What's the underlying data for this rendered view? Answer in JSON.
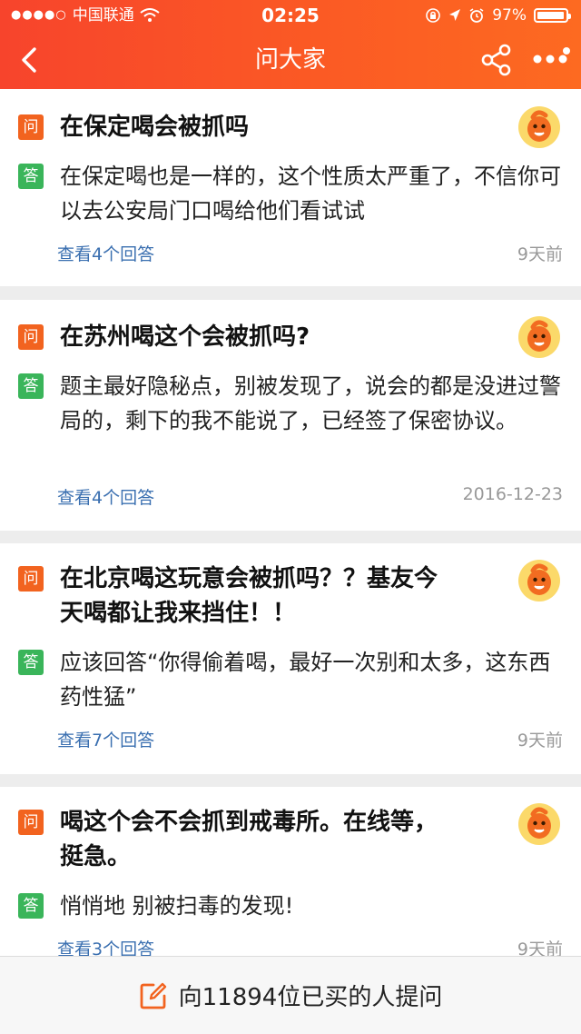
{
  "status_bar": {
    "carrier": "中国联通",
    "time": "02:25",
    "battery": "97%",
    "battery_level": 0.97,
    "icons": [
      "signal-dots-icon",
      "wifi-icon",
      "lock-rotation-icon",
      "location-icon",
      "alarm-icon",
      "battery-icon"
    ]
  },
  "navbar": {
    "title": "问大家",
    "icons": [
      "back-icon",
      "share-icon",
      "more-icon"
    ]
  },
  "labels": {
    "question_badge": "问",
    "answer_badge": "答"
  },
  "questions": [
    {
      "question": "在保定喝会被抓吗",
      "answer": "在保定喝也是一样的，这个性质太严重了，不信你可以去公安局门口喝给他们看试试",
      "view_answers": "查看4个回答",
      "time": "9天前"
    },
    {
      "question": "在苏州喝这个会被抓吗?",
      "answer": "题主最好隐秘点，别被发现了，说会的都是没进过警局的，剩下的我不能说了，已经签了保密协议。",
      "view_answers": "查看4个回答",
      "time": "2016-12-23"
    },
    {
      "question": "在北京喝这玩意会被抓吗？？基友今天喝都让我来挡住！！",
      "answer": "应该回答“你得偷着喝，最好一次别和太多，这东西药性猛”",
      "view_answers": "查看7个回答",
      "time": "9天前"
    },
    {
      "question": "喝这个会不会抓到戒毒所。在线等，挺急。",
      "answer": "悄悄地 别被扫毒的发现!",
      "view_answers": "查看3个回答",
      "time": "9天前"
    }
  ],
  "bottom_bar": {
    "ask_label": "向11894位已买的人提问",
    "icon": "edit-icon"
  },
  "colors": {
    "header_gradient_start": "#f7442c",
    "header_gradient_end": "#fd6a21",
    "question_badge": "#f2631f",
    "answer_badge": "#3ab55a",
    "link": "#3a6fb0"
  }
}
